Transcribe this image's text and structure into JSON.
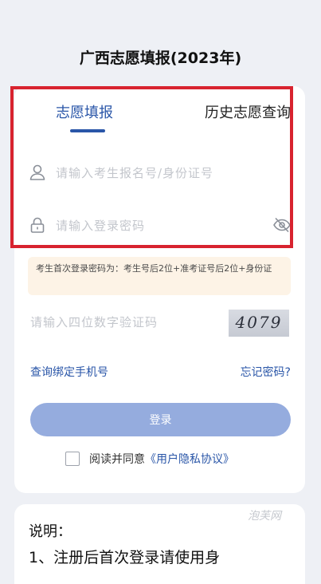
{
  "page": {
    "title": "广西志愿填报(2023年)"
  },
  "tabs": [
    {
      "label": "志愿填报",
      "active": true
    },
    {
      "label": "历史志愿查询",
      "active": false
    }
  ],
  "form": {
    "account_placeholder": "请输入考生报名号/身份证号",
    "password_placeholder": "请输入登录密码",
    "notice": "考生首次登录密码为：考生号后2位+准考证号后2位+身份证",
    "captcha_placeholder": "请输入四位数字验证码",
    "captcha_code": "4079",
    "bind_phone_link": "查询绑定手机号",
    "forgot_password_link": "忘记密码?",
    "login_button": "登录",
    "agree_text": "阅读并同意",
    "agree_link": "《用户隐私协议》"
  },
  "explanation": {
    "title": "说明：",
    "line1": "1、注册后首次登录请使用身"
  },
  "watermark": "泡芙网",
  "colors": {
    "accent": "#2a56a8",
    "button": "#95acde",
    "highlight_border": "#d8232f",
    "notice_bg": "#fdf3e6"
  },
  "icons": [
    "user-icon",
    "lock-icon",
    "eye-off-icon"
  ]
}
